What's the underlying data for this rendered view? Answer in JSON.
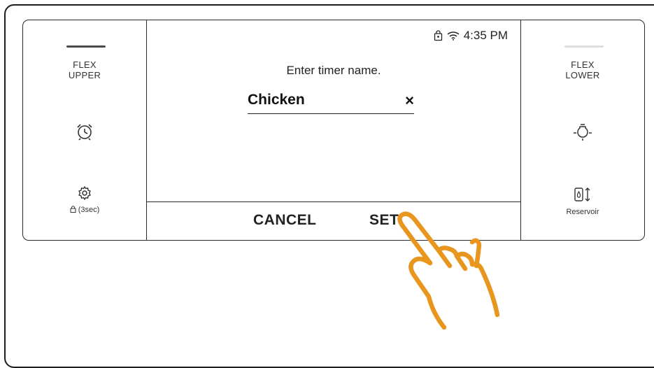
{
  "panel": {
    "left": {
      "zone_label_line1": "FLEX",
      "zone_label_line2": "UPPER",
      "timer_icon": "alarm-clock-icon",
      "settings_icon": "gear-icon",
      "lock_label": "(3sec)"
    },
    "right": {
      "zone_label_line1": "FLEX",
      "zone_label_line2": "LOWER",
      "light_icon": "light-bulb-icon",
      "reservoir_icon": "reservoir-icon",
      "reservoir_label": "Reservoir"
    },
    "screen": {
      "status": {
        "time": "4:35 PM",
        "icons": [
          "lock-icon",
          "wifi-icon"
        ]
      },
      "prompt": "Enter timer name.",
      "name_field": {
        "value": "Chicken",
        "clear_symbol": "×"
      },
      "actions": {
        "cancel_label": "CANCEL",
        "set_label": "SET"
      }
    }
  },
  "colors": {
    "outline": "#222222",
    "hand_pointer": "#E8961E",
    "inactive_bar": "#DEDEDE",
    "active_bar": "#4A4A4A"
  }
}
